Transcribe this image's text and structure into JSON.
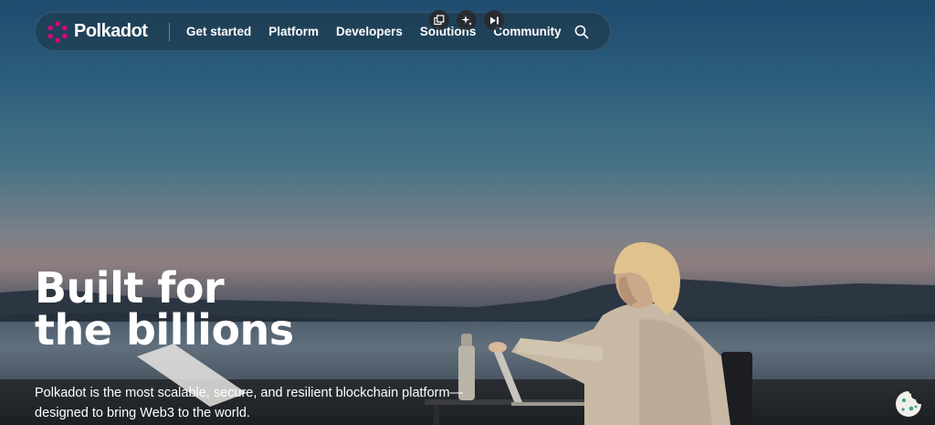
{
  "brand": {
    "name": "Polkadot",
    "logo_color": "#E6007A"
  },
  "nav": {
    "items": [
      {
        "label": "Get started"
      },
      {
        "label": "Platform"
      },
      {
        "label": "Developers"
      },
      {
        "label": "Solutions"
      },
      {
        "label": "Community"
      }
    ],
    "search_icon": "search-icon"
  },
  "toolbar": {
    "icons": [
      "copy-icon",
      "sparkle-icon",
      "skip-forward-icon"
    ]
  },
  "hero": {
    "headline_line1": "Built for",
    "headline_line2": "the billions",
    "description_line1": "Polkadot is the most scalable, secure, and resilient blockchain platform—",
    "description_line2": "designed to bring Web3 to the world."
  },
  "cookie": {
    "icon": "cookie-icon"
  }
}
